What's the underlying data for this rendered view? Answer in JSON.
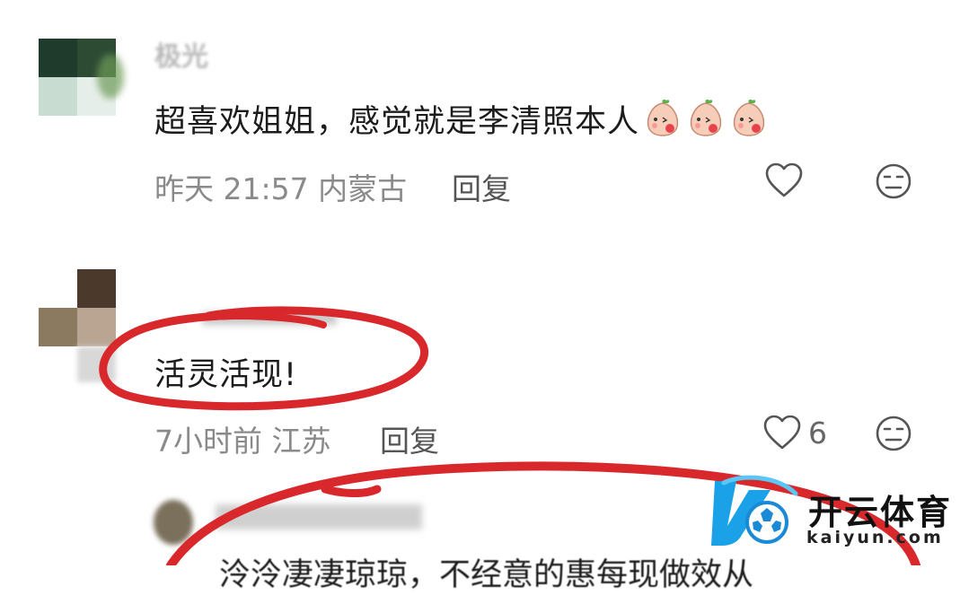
{
  "comments": [
    {
      "username": "极光",
      "text": "超喜欢姐姐，感觉就是李清照本人",
      "emojis": [
        "peach-kiss-emoji",
        "peach-kiss-emoji",
        "peach-kiss-emoji"
      ],
      "time": "昨天 21:57",
      "location": "内蒙古",
      "reply_label": "回复",
      "like_count": "",
      "avatar_colors": [
        "#1f3b2c",
        "#2a4a32",
        "#cfe0d8",
        "#e3ece6"
      ]
    },
    {
      "username": "",
      "text": "活灵活现!",
      "time": "7小时前",
      "location": "江苏",
      "reply_label": "回复",
      "like_count": "6",
      "avatar_colors": [
        "#ffffff",
        "#4a3a2c",
        "#8c7a62",
        "#b8a390"
      ]
    }
  ],
  "nested_reply": {
    "text": "泠泠凄凄琼琼，不经意的惠每现做效从"
  },
  "watermark": {
    "brand": "开云体育",
    "url": "kaiyun.com"
  },
  "colors": {
    "annotation_red": "#d9282b",
    "meta_gray": "#8a8a8a",
    "brand_blue": "#1aa1e8"
  }
}
